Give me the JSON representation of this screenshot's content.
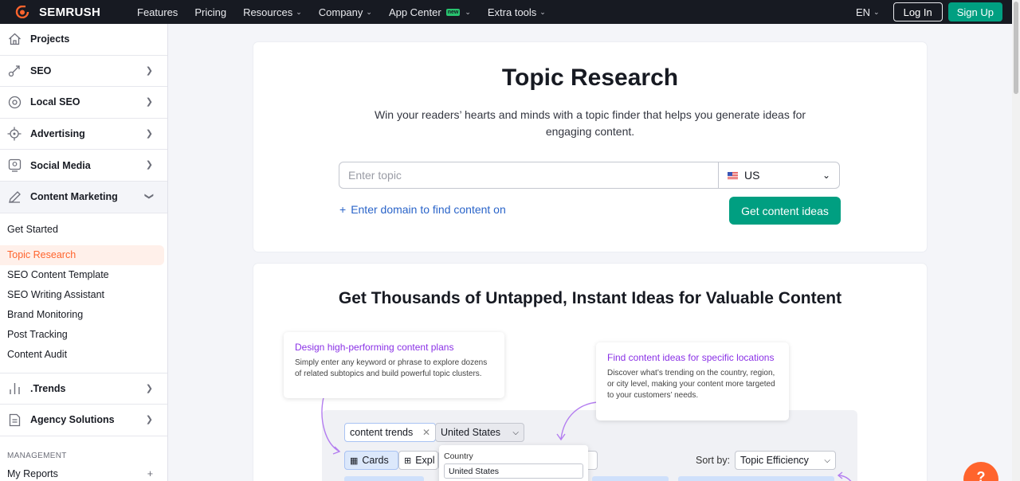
{
  "brand": {
    "name": "SEMRUSH",
    "accent": "#ff642d",
    "green": "#009f81",
    "link": "#2a64c9"
  },
  "topnav": {
    "links": [
      {
        "label": "Features"
      },
      {
        "label": "Pricing"
      },
      {
        "label": "Resources"
      },
      {
        "label": "Company"
      },
      {
        "label": "App Center",
        "badge": "new"
      },
      {
        "label": "Extra tools"
      }
    ],
    "lang": "EN",
    "login": "Log In",
    "signup": "Sign Up"
  },
  "sidebar": {
    "items": [
      {
        "label": "Projects",
        "icon": "home-icon"
      },
      {
        "label": "SEO",
        "icon": "seo-icon"
      },
      {
        "label": "Local SEO",
        "icon": "location-icon"
      },
      {
        "label": "Advertising",
        "icon": "target-icon"
      },
      {
        "label": "Social Media",
        "icon": "social-icon"
      },
      {
        "label": "Content Marketing",
        "icon": "pencil-icon"
      }
    ],
    "content_marketing_sub": [
      "Get Started",
      "Topic Research",
      "SEO Content Template",
      "SEO Writing Assistant",
      "Brand Monitoring",
      "Post Tracking",
      "Content Audit"
    ],
    "trends": ".Trends",
    "agency": "Agency Solutions",
    "management_heading": "MANAGEMENT",
    "my_reports": "My Reports",
    "my_reports_add": "+"
  },
  "hero": {
    "title": "Topic Research",
    "subtitle": "Win your readers’ hearts and minds with a topic finder that helps you generate ideas for engaging content.",
    "topic_placeholder": "Enter topic",
    "country": "US",
    "domain_link": "Enter domain to find content on",
    "cta": "Get content ideas"
  },
  "features": {
    "title": "Get Thousands of Untapped, Instant Ideas for Valuable Content",
    "tip1": {
      "title": "Design high-performing content plans",
      "desc": "Simply enter any keyword or phrase to explore dozens of related subtopics and build powerful topic clusters."
    },
    "tip2": {
      "title": "Find content ideas for specific locations",
      "desc": "Discover what’s trending on the country, region, or city level, making your content more targeted to your customers’ needs."
    },
    "demo": {
      "query": "content trends",
      "country": "United States",
      "cards": "Cards",
      "explorer": "Expl",
      "sort_label": "Sort by:",
      "sort_value": "Topic Efficiency",
      "popover_label": "Country",
      "popover_value": "United States"
    }
  },
  "help": "?"
}
